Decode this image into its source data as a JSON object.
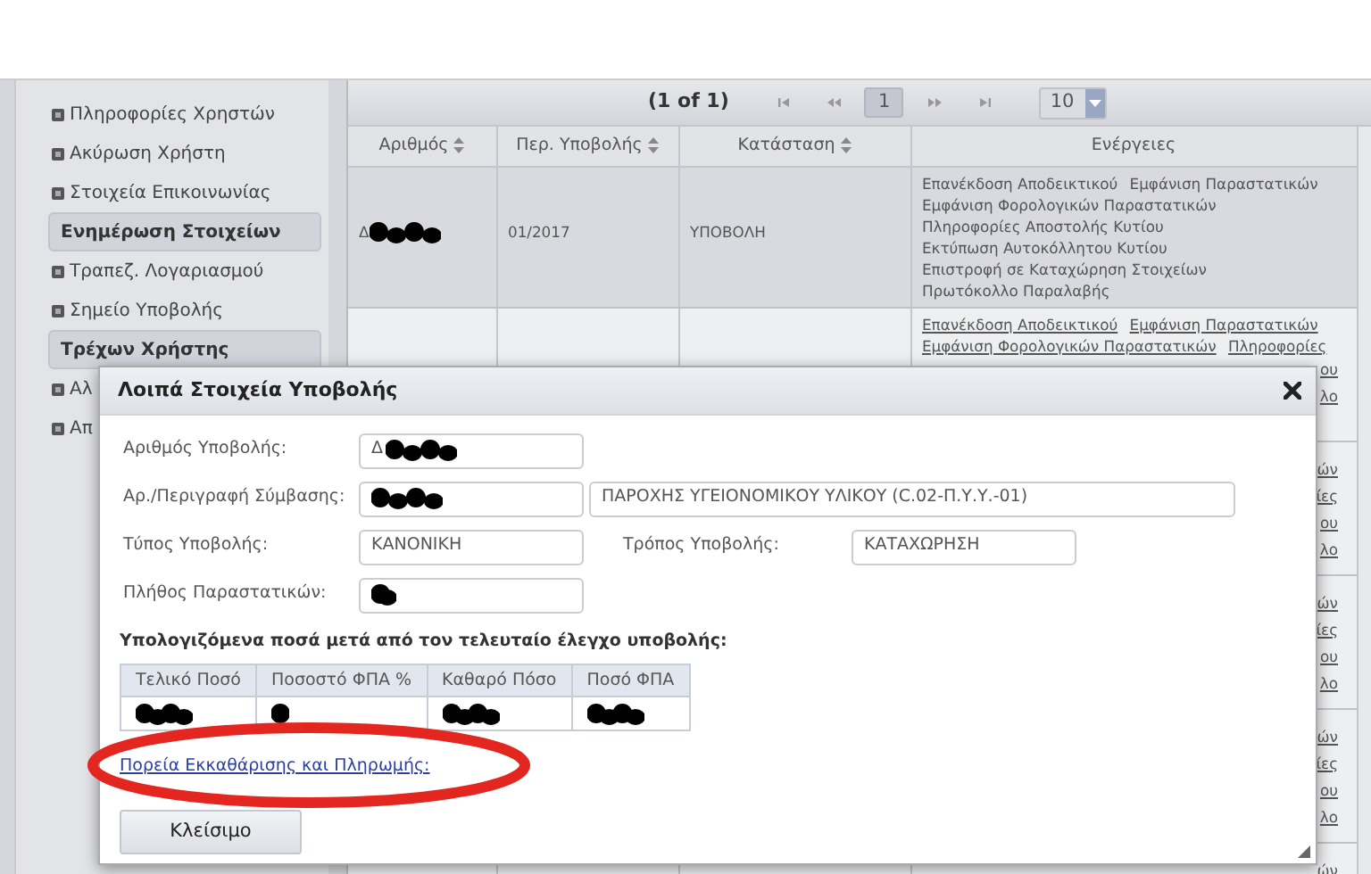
{
  "sidebar": {
    "items": [
      {
        "kind": "link",
        "label": "Πληροφορίες Χρηστών"
      },
      {
        "kind": "link",
        "label": "Ακύρωση Χρήστη"
      },
      {
        "kind": "link",
        "label": "Στοιχεία Επικοινωνίας"
      },
      {
        "kind": "header",
        "label": "Ενημέρωση Στοιχείων"
      },
      {
        "kind": "link",
        "label": "Τραπεζ. Λογαριασμού"
      },
      {
        "kind": "link",
        "label": "Σημείο Υποβολής"
      },
      {
        "kind": "header",
        "label": "Τρέχων Χρήστης"
      },
      {
        "kind": "link",
        "label": "Αλ"
      },
      {
        "kind": "link",
        "label": "Απ"
      }
    ]
  },
  "table": {
    "pager": {
      "summary": "(1 of 1)",
      "page": "1",
      "page_size": "10"
    },
    "columns": [
      "Αριθμός",
      "Περ. Υποβολής",
      "Κατάσταση",
      "Ενέργειες"
    ],
    "rows": [
      {
        "number": "Δ",
        "number_redacted": true,
        "period": "01/2017",
        "status": "ΥΠΟΒΟΛΗ",
        "selected": true,
        "actions": [
          "Επανέκδοση Αποδεικτικού",
          "Εμφάνιση Παραστατικών",
          "Εμφάνιση Φορολογικών Παραστατικών",
          "Πληροφορίες Αποστολής Κυτίου",
          "Εκτύπωση Αυτοκόλλητου Κυτίου",
          "Επιστροφή σε Καταχώρηση Στοιχείων",
          "Πρωτόκολλο Παραλαβής"
        ],
        "action_tails": []
      },
      {
        "selected": false,
        "actions": [
          "Επανέκδοση Αποδεικτικού",
          "Εμφάνιση Παραστατικών",
          "Εμφάνιση Φορολογικών Παραστατικών",
          "Πληροφορίες"
        ],
        "action_tails": [
          "ου",
          "λο"
        ]
      },
      {
        "actions": [],
        "action_tails": [
          "ών",
          "ίες",
          "ου",
          "λο"
        ]
      },
      {
        "actions": [],
        "action_tails": [
          "ών",
          "ίες",
          "ου",
          "λο"
        ]
      },
      {
        "actions": [],
        "action_tails": [
          "ών",
          "ίες",
          "ου",
          "λο"
        ]
      },
      {
        "actions": [],
        "action_tails": [
          "ών"
        ]
      }
    ]
  },
  "dialog": {
    "title": "Λοιπά Στοιχεία Υποβολής",
    "fields": [
      {
        "label": "Αριθμός Υποβολής:",
        "value": "Δ",
        "redacted": true
      },
      {
        "label": "Αρ./Περιγραφή Σύμβασης:",
        "redacted": true,
        "extra_value": "ΠΑΡΟΧΗΣ ΥΓΕΙΟΝΟΜΙΚΟΥ ΥΛΙΚΟΥ (C.02-Π.Υ.Υ.-01)"
      },
      {
        "label": "Τύπος Υποβολής:",
        "value": "ΚΑΝΟΝΙΚΗ",
        "side_label": "Τρόπος Υποβολής:",
        "side_value": "ΚΑΤΑΧΩΡΗΣΗ"
      },
      {
        "label": "Πλήθος Παραστατικών:",
        "redacted": true
      }
    ],
    "amounts_title": "Υπολογιζόμενα ποσά μετά από τον τελευταίο έλεγχο υποβολής:",
    "amounts": {
      "columns": [
        "Τελικό Ποσό",
        "Ποσοστό ΦΠΑ %",
        "Καθαρό Πόσο",
        "Ποσό ΦΠΑ"
      ],
      "redacted": [
        true,
        true,
        true,
        true
      ]
    },
    "link": "Πορεία Εκκαθάρισης και Πληρωμής:",
    "link_circled": true,
    "close_button": "Κλείσιμο"
  }
}
